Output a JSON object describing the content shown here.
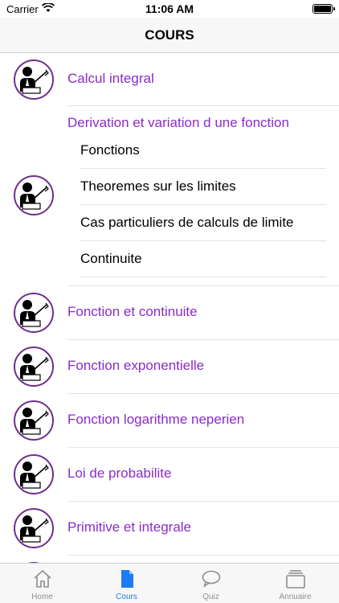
{
  "status_bar": {
    "carrier": "Carrier",
    "time": "11:06 AM"
  },
  "nav": {
    "title": "COURS"
  },
  "courses": [
    {
      "label": "Calcul integral"
    },
    {
      "label": "Derivation et variation d une fonction",
      "subitems": [
        {
          "label": "Fonctions"
        },
        {
          "label": "Theoremes sur les limites"
        },
        {
          "label": "Cas particuliers de calculs de limite"
        },
        {
          "label": "Continuite"
        }
      ]
    },
    {
      "label": "Fonction et continuite"
    },
    {
      "label": "Fonction exponentielle"
    },
    {
      "label": "Fonction logarithme neperien"
    },
    {
      "label": "Loi de probabilite"
    },
    {
      "label": "Primitive et integrale"
    }
  ],
  "tabs": [
    {
      "label": "Home",
      "icon": "home-icon"
    },
    {
      "label": "Cours",
      "icon": "document-icon",
      "active": true
    },
    {
      "label": "Quiz",
      "icon": "chat-bubble-icon"
    },
    {
      "label": "Annuaire",
      "icon": "cards-icon"
    }
  ],
  "colors": {
    "accent": "#8a2bc9",
    "tab_active": "#1c7cf4",
    "tab_inactive": "#8e8e93",
    "avatar_ring": "#6d2f8a"
  }
}
